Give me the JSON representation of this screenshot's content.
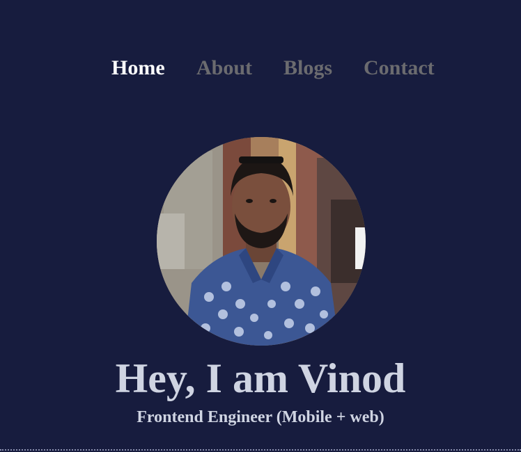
{
  "nav": {
    "items": [
      {
        "label": "Home",
        "active": true
      },
      {
        "label": "About",
        "active": false
      },
      {
        "label": "Blogs",
        "active": false
      },
      {
        "label": "Contact",
        "active": false
      }
    ]
  },
  "hero": {
    "avatar_icon": "profile-photo",
    "headline": "Hey, I am Vinod",
    "subtitle": "Frontend Engineer (Mobile + web)"
  },
  "colors": {
    "background": "#171c3e",
    "nav_active": "#ffffff",
    "nav_inactive": "#6b6b6f",
    "heading_text": "#cfd4e2"
  }
}
